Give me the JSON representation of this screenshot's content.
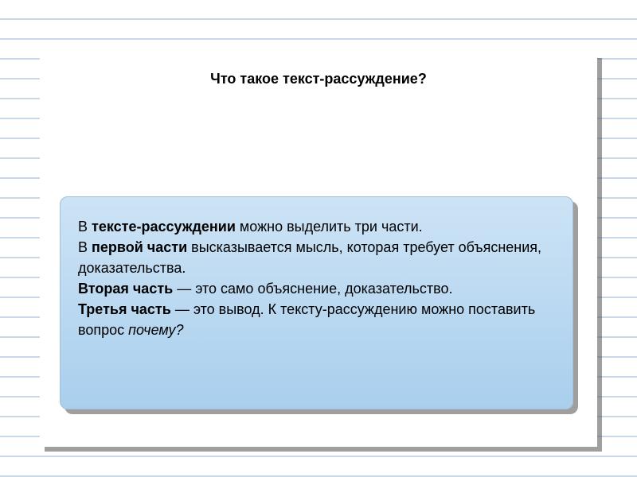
{
  "slide": {
    "heading": "Что такое текст-рассуждение?",
    "content": {
      "l1_open": "В ",
      "l1_bold": "тексте-рассуждении",
      "l1_rest": " можно выделить три части.",
      "l2_open": "В ",
      "l2_bold": "первой части",
      "l2_rest": " высказывается мысль, которая требует объяснения, доказательства.",
      "l3_bold": "Вторая часть",
      "l3_rest": " — это само объяснение, доказательство.",
      "l4_bold": "Третья часть",
      "l4_rest": " — это вывод. К тексту-рассуждению можно поставить вопрос ",
      "l4_italic": "почему?"
    }
  }
}
